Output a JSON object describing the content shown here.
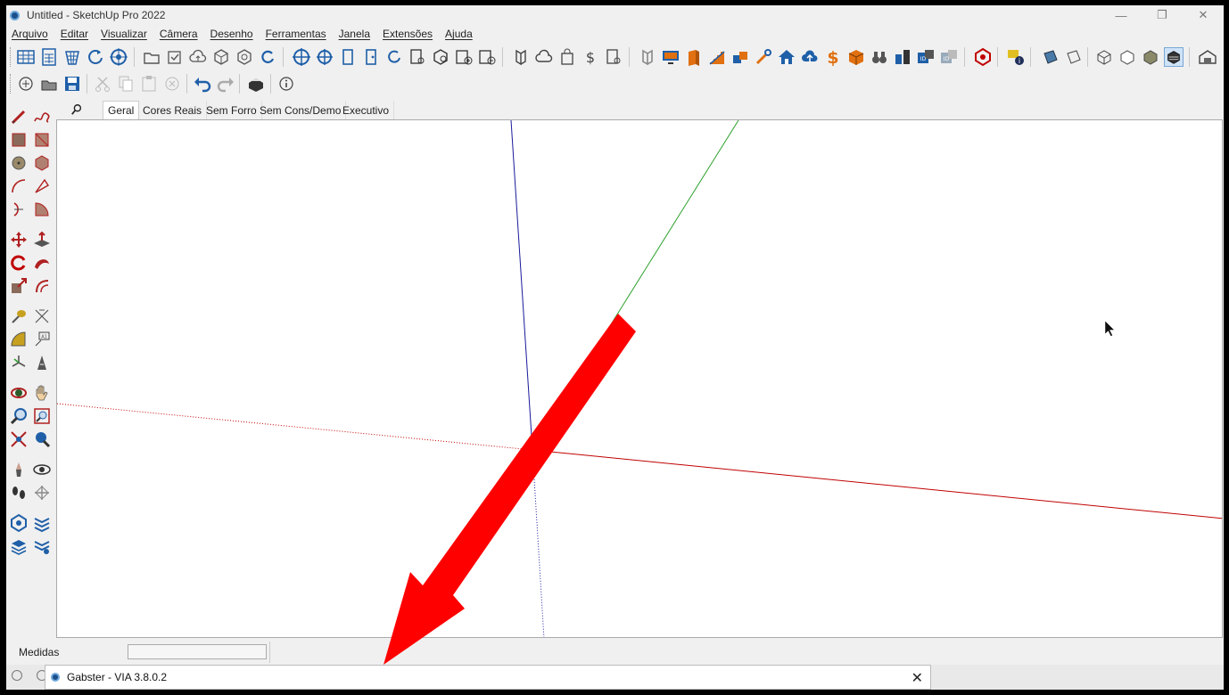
{
  "window": {
    "title": "Untitled - SketchUp Pro 2022",
    "minimize_glyph": "—",
    "maximize_glyph": "❐",
    "close_glyph": "✕"
  },
  "menu": [
    "Arquivo",
    "Editar",
    "Visualizar",
    "Câmera",
    "Desenho",
    "Ferramentas",
    "Janela",
    "Extensões",
    "Ajuda"
  ],
  "scene_tabs": [
    "Geral",
    "Cores Reais",
    "Sem Forro",
    "Sem Cons/Demo",
    "Executivo"
  ],
  "active_scene_tab": "Geral",
  "status_bar": {
    "measurements_label": "Medidas",
    "measurements_value": ""
  },
  "gabster_window": {
    "title": "Gabster - VIA 3.8.0.2",
    "close_glyph": "✕"
  },
  "colors": {
    "axis_red": "#c00000",
    "axis_green": "#2ca02c",
    "axis_blue": "#1a1a9a",
    "annotation_arrow": "#ff0000",
    "icon_blue": "#1f5fa8",
    "icon_orange": "#e07010"
  }
}
